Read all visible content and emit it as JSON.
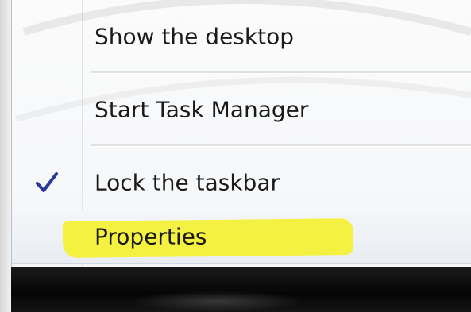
{
  "context_menu": {
    "items": [
      {
        "label": "Show the desktop",
        "checked": false,
        "highlighted": false
      },
      {
        "label": "Start Task Manager",
        "checked": false,
        "highlighted": false
      },
      {
        "label": "Lock the taskbar",
        "checked": true,
        "highlighted": false
      },
      {
        "label": "Properties",
        "checked": false,
        "highlighted": true
      }
    ]
  },
  "icons": {
    "check": "checkmark-icon"
  },
  "colors": {
    "highlighter": "#f5f12d",
    "checkmark": "#2b3a9a",
    "taskbar": "#0a0a0a",
    "menu_background": "#f8f9fa"
  }
}
